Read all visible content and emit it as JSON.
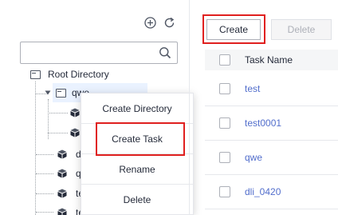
{
  "tree_panel": {
    "search": {
      "value": "",
      "placeholder": ""
    },
    "root_label": "Root Directory",
    "items": [
      {
        "label": "qwe",
        "type": "folder",
        "selected": true
      },
      {
        "label": "",
        "type": "task"
      },
      {
        "label": "",
        "type": "task"
      },
      {
        "label": "d",
        "type": "task"
      },
      {
        "label": "q",
        "type": "task"
      },
      {
        "label": "te",
        "type": "task"
      },
      {
        "label": "te",
        "type": "task"
      }
    ]
  },
  "context_menu": {
    "items": [
      {
        "label": "Create Directory"
      },
      {
        "label": "Create Task",
        "highlighted": true
      },
      {
        "label": "Rename"
      },
      {
        "label": "Delete"
      }
    ]
  },
  "toolbar": {
    "create_label": "Create",
    "delete_label": "Delete"
  },
  "table": {
    "column_task_name": "Task Name",
    "rows": [
      {
        "name": "test"
      },
      {
        "name": "test0001"
      },
      {
        "name": "qwe"
      },
      {
        "name": "dli_0420"
      }
    ]
  },
  "colors": {
    "highlight": "#e0201f",
    "link": "#526ecc",
    "selected_bg": "#eaf2ff"
  }
}
